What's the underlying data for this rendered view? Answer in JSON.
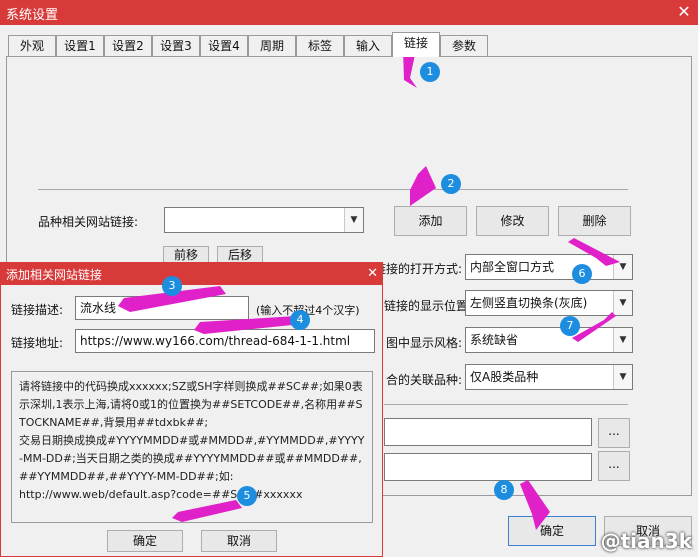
{
  "window": {
    "title": "系统设置",
    "close_glyph": "✕"
  },
  "tabs": [
    "外观",
    "设置1",
    "设置2",
    "设置3",
    "设置4",
    "周期",
    "标签",
    "输入",
    "链接",
    "参数"
  ],
  "active_tab": "链接",
  "main": {
    "link_label": "品种相关网站链接:",
    "link_value": "",
    "add_button": "添加",
    "modify_button": "修改",
    "delete_button": "删除",
    "btn_up": "前移",
    "btn_down": "后移",
    "open_mode_label": "网站链接的打开方式:",
    "open_mode_value": "内部全窗口方式",
    "display_pos_label": "链接的显示位置:",
    "display_pos_value": "左侧竖直切换条(灰底)",
    "style_label": "图中显示风格:",
    "style_value": "系统缺省",
    "related_label": "合的关联品种:",
    "related_value": "仅A股类品种",
    "browse1": "...",
    "browse2": "...",
    "ok_button": "确定",
    "cancel_button": "取消"
  },
  "dialog": {
    "title": "添加相关网站链接",
    "close_glyph": "✕",
    "desc_label": "链接描述:",
    "desc_value": "流水线",
    "desc_hint": "(输入不超过4个汉字)",
    "url_label": "链接地址:",
    "url_value": "https://www.wy166.com/thread-684-1-1.html",
    "note": "请将链接中的代码换成xxxxxx;SZ或SH字样则换成##SC##;如果0表示深圳,1表示上海,请将0或1的位置换为##SETCODE##,名称用##STOCKNAME##,背景用##tdxbk##;\n交易日期换成换成#YYYYMMDD#或#MMDD#,#YYMMDD#,#YYYY-MM-DD#;当天日期之类的换成##YYYYMMDD##或##MMDD##,##YYMMDD##,##YYYY-MM-DD##;如:\nhttp://www.web/default.asp?code=##SC##xxxxxx",
    "ok_button": "确定",
    "cancel_button": "取消"
  },
  "annotations": [
    "1",
    "2",
    "3",
    "4",
    "5",
    "6",
    "7",
    "8"
  ],
  "annotation_color": "#e020c8",
  "badge_color": "#1d8de0",
  "accent_color": "#d83a3a",
  "watermark": "@tian3k"
}
